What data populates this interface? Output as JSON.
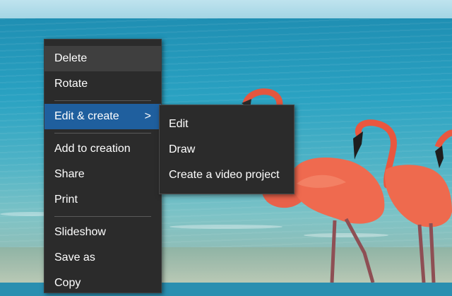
{
  "colors": {
    "menu_bg": "#2b2b2b",
    "menu_hover": "#3f3f3f",
    "menu_active": "#1f5f9e",
    "menu_text": "#ffffff",
    "separator": "#5a5a5a"
  },
  "context_menu": {
    "items": [
      {
        "label": "Delete"
      },
      {
        "label": "Rotate"
      },
      {
        "label": "Edit & create",
        "chevron": ">"
      },
      {
        "label": "Add to creation"
      },
      {
        "label": "Share"
      },
      {
        "label": "Print"
      },
      {
        "label": "Slideshow"
      },
      {
        "label": "Save as"
      },
      {
        "label": "Copy"
      }
    ]
  },
  "submenu": {
    "items": [
      {
        "label": "Edit"
      },
      {
        "label": "Draw"
      },
      {
        "label": "Create a video project"
      }
    ]
  }
}
